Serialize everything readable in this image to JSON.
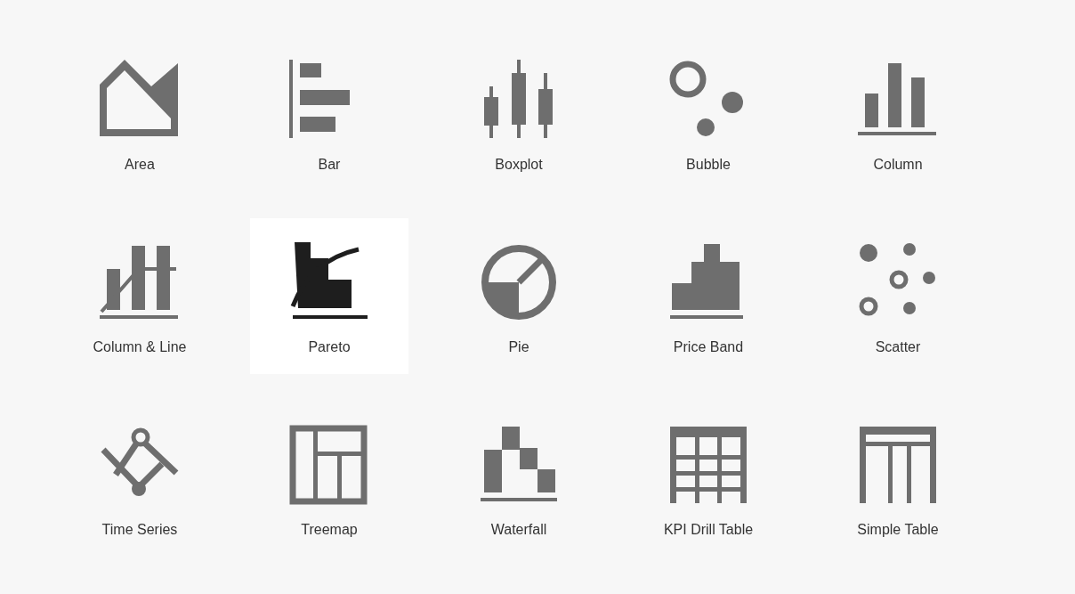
{
  "charts": [
    {
      "label": "Area",
      "selected": false
    },
    {
      "label": "Bar",
      "selected": false
    },
    {
      "label": "Boxplot",
      "selected": false
    },
    {
      "label": "Bubble",
      "selected": false
    },
    {
      "label": "Column",
      "selected": false
    },
    {
      "label": "Column & Line",
      "selected": false
    },
    {
      "label": "Pareto",
      "selected": true
    },
    {
      "label": "Pie",
      "selected": false
    },
    {
      "label": "Price Band",
      "selected": false
    },
    {
      "label": "Scatter",
      "selected": false
    },
    {
      "label": "Time Series",
      "selected": false
    },
    {
      "label": "Treemap",
      "selected": false
    },
    {
      "label": "Waterfall",
      "selected": false
    },
    {
      "label": "KPI Drill Table",
      "selected": false
    },
    {
      "label": "Simple Table",
      "selected": false
    }
  ]
}
